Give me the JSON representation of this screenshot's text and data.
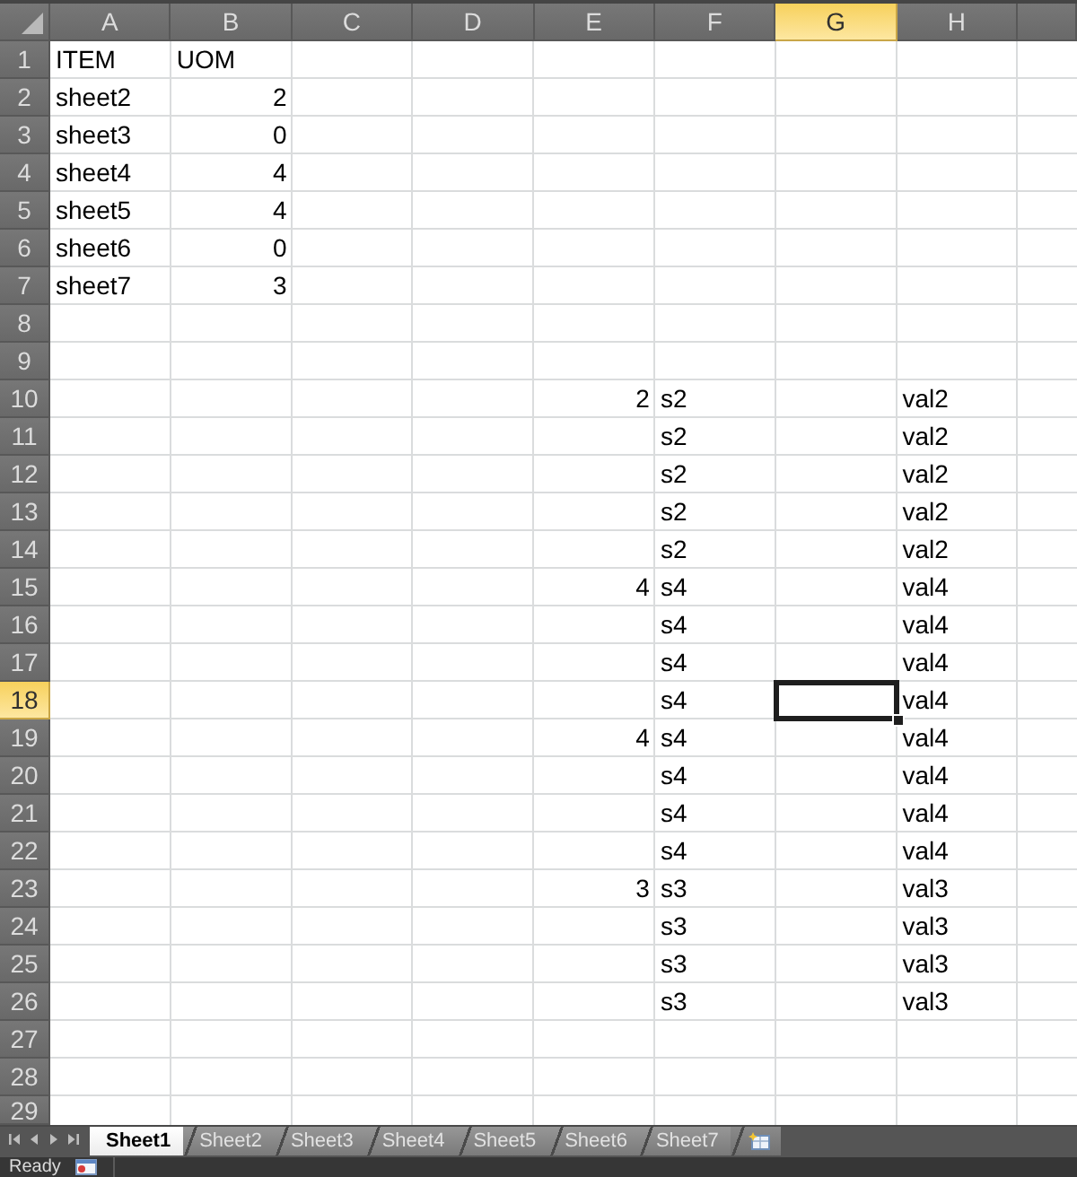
{
  "columns": [
    {
      "label": "A",
      "selected": false
    },
    {
      "label": "B",
      "selected": false
    },
    {
      "label": "C",
      "selected": false
    },
    {
      "label": "D",
      "selected": false
    },
    {
      "label": "E",
      "selected": false
    },
    {
      "label": "F",
      "selected": false
    },
    {
      "label": "G",
      "selected": true
    },
    {
      "label": "H",
      "selected": false
    },
    {
      "selected": false
    }
  ],
  "rows": [
    {
      "number": "1",
      "selected": false,
      "cells": {
        "A": {
          "text": "ITEM",
          "kind": "text"
        },
        "B": {
          "text": "UOM",
          "kind": "text"
        }
      }
    },
    {
      "number": "2",
      "selected": false,
      "cells": {
        "A": {
          "text": "sheet2",
          "kind": "text"
        },
        "B": {
          "text": "2",
          "kind": "number"
        }
      }
    },
    {
      "number": "3",
      "selected": false,
      "cells": {
        "A": {
          "text": "sheet3",
          "kind": "text"
        },
        "B": {
          "text": "0",
          "kind": "number"
        }
      }
    },
    {
      "number": "4",
      "selected": false,
      "cells": {
        "A": {
          "text": "sheet4",
          "kind": "text"
        },
        "B": {
          "text": "4",
          "kind": "number"
        }
      }
    },
    {
      "number": "5",
      "selected": false,
      "cells": {
        "A": {
          "text": "sheet5",
          "kind": "text"
        },
        "B": {
          "text": "4",
          "kind": "number"
        }
      }
    },
    {
      "number": "6",
      "selected": false,
      "cells": {
        "A": {
          "text": "sheet6",
          "kind": "text"
        },
        "B": {
          "text": "0",
          "kind": "number"
        }
      }
    },
    {
      "number": "7",
      "selected": false,
      "cells": {
        "A": {
          "text": "sheet7",
          "kind": "text"
        },
        "B": {
          "text": "3",
          "kind": "number"
        }
      }
    },
    {
      "number": "8",
      "selected": false
    },
    {
      "number": "9",
      "selected": false
    },
    {
      "number": "10",
      "selected": false,
      "cells": {
        "E": {
          "text": "2",
          "kind": "number"
        },
        "F": {
          "text": "s2",
          "kind": "text"
        },
        "H": {
          "text": "val2",
          "kind": "text"
        }
      }
    },
    {
      "number": "11",
      "selected": false,
      "cells": {
        "F": {
          "text": "s2",
          "kind": "text"
        },
        "H": {
          "text": "val2",
          "kind": "text"
        }
      }
    },
    {
      "number": "12",
      "selected": false,
      "cells": {
        "F": {
          "text": "s2",
          "kind": "text"
        },
        "H": {
          "text": "val2",
          "kind": "text"
        }
      }
    },
    {
      "number": "13",
      "selected": false,
      "cells": {
        "F": {
          "text": "s2",
          "kind": "text"
        },
        "H": {
          "text": "val2",
          "kind": "text"
        }
      }
    },
    {
      "number": "14",
      "selected": false,
      "cells": {
        "F": {
          "text": "s2",
          "kind": "text"
        },
        "H": {
          "text": "val2",
          "kind": "text"
        }
      }
    },
    {
      "number": "15",
      "selected": false,
      "cells": {
        "E": {
          "text": "4",
          "kind": "number"
        },
        "F": {
          "text": "s4",
          "kind": "text"
        },
        "H": {
          "text": "val4",
          "kind": "text"
        }
      }
    },
    {
      "number": "16",
      "selected": false,
      "cells": {
        "F": {
          "text": "s4",
          "kind": "text"
        },
        "H": {
          "text": "val4",
          "kind": "text"
        }
      }
    },
    {
      "number": "17",
      "selected": false,
      "cells": {
        "F": {
          "text": "s4",
          "kind": "text"
        },
        "H": {
          "text": "val4",
          "kind": "text"
        }
      }
    },
    {
      "number": "18",
      "selected": true,
      "cells": {
        "F": {
          "text": "s4",
          "kind": "text"
        },
        "H": {
          "text": "val4",
          "kind": "text"
        }
      }
    },
    {
      "number": "19",
      "selected": false,
      "cells": {
        "E": {
          "text": "4",
          "kind": "number"
        },
        "F": {
          "text": "s4",
          "kind": "text"
        },
        "H": {
          "text": "val4",
          "kind": "text"
        }
      }
    },
    {
      "number": "20",
      "selected": false,
      "cells": {
        "F": {
          "text": "s4",
          "kind": "text"
        },
        "H": {
          "text": "val4",
          "kind": "text"
        }
      }
    },
    {
      "number": "21",
      "selected": false,
      "cells": {
        "F": {
          "text": "s4",
          "kind": "text"
        },
        "H": {
          "text": "val4",
          "kind": "text"
        }
      }
    },
    {
      "number": "22",
      "selected": false,
      "cells": {
        "F": {
          "text": "s4",
          "kind": "text"
        },
        "H": {
          "text": "val4",
          "kind": "text"
        }
      }
    },
    {
      "number": "23",
      "selected": false,
      "cells": {
        "E": {
          "text": "3",
          "kind": "number"
        },
        "F": {
          "text": "s3",
          "kind": "text"
        },
        "H": {
          "text": "val3",
          "kind": "text"
        }
      }
    },
    {
      "number": "24",
      "selected": false,
      "cells": {
        "F": {
          "text": "s3",
          "kind": "text"
        },
        "H": {
          "text": "val3",
          "kind": "text"
        }
      }
    },
    {
      "number": "25",
      "selected": false,
      "cells": {
        "F": {
          "text": "s3",
          "kind": "text"
        },
        "H": {
          "text": "val3",
          "kind": "text"
        }
      }
    },
    {
      "number": "26",
      "selected": false,
      "cells": {
        "F": {
          "text": "s3",
          "kind": "text"
        },
        "H": {
          "text": "val3",
          "kind": "text"
        }
      }
    },
    {
      "number": "27",
      "selected": false
    },
    {
      "number": "28",
      "selected": false
    },
    {
      "number": "29",
      "selected": false
    }
  ],
  "sheets": [
    {
      "label": "Sheet1",
      "selected": true
    },
    {
      "label": "Sheet2",
      "selected": false
    },
    {
      "label": "Sheet3",
      "selected": false
    },
    {
      "label": "Sheet4",
      "selected": false
    },
    {
      "label": "Sheet5",
      "selected": false
    },
    {
      "label": "Sheet6",
      "selected": false
    },
    {
      "label": "Sheet7",
      "selected": false
    }
  ],
  "status_bar": {
    "text": "Ready"
  }
}
